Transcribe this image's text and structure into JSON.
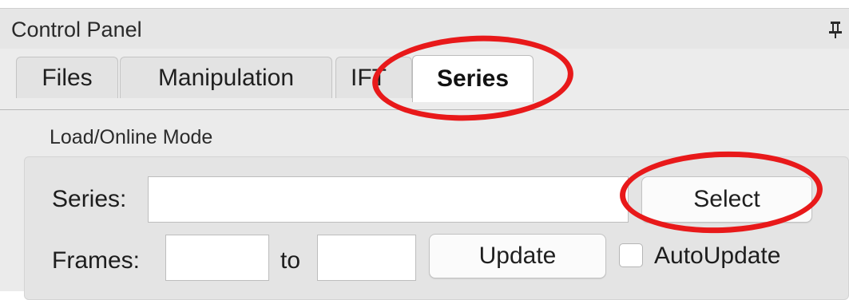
{
  "panel": {
    "title": "Control Panel",
    "pin_icon": "pin-icon"
  },
  "tabs": [
    {
      "label": "Files",
      "active": false
    },
    {
      "label": "Manipulation",
      "active": false
    },
    {
      "label": "IFT",
      "active": false
    },
    {
      "label": "Series",
      "active": true
    }
  ],
  "group": {
    "label": "Load/Online Mode",
    "series_label": "Series:",
    "series_value": "",
    "select_button": "Select",
    "frames_label": "Frames:",
    "frames_from_value": "",
    "to_label": "to",
    "frames_to_value": "",
    "update_button": "Update",
    "autoupdate_label": "AutoUpdate",
    "autoupdate_checked": false
  },
  "annotations": {
    "color": "#e8191a",
    "highlighted": [
      "Series",
      "Select"
    ]
  }
}
